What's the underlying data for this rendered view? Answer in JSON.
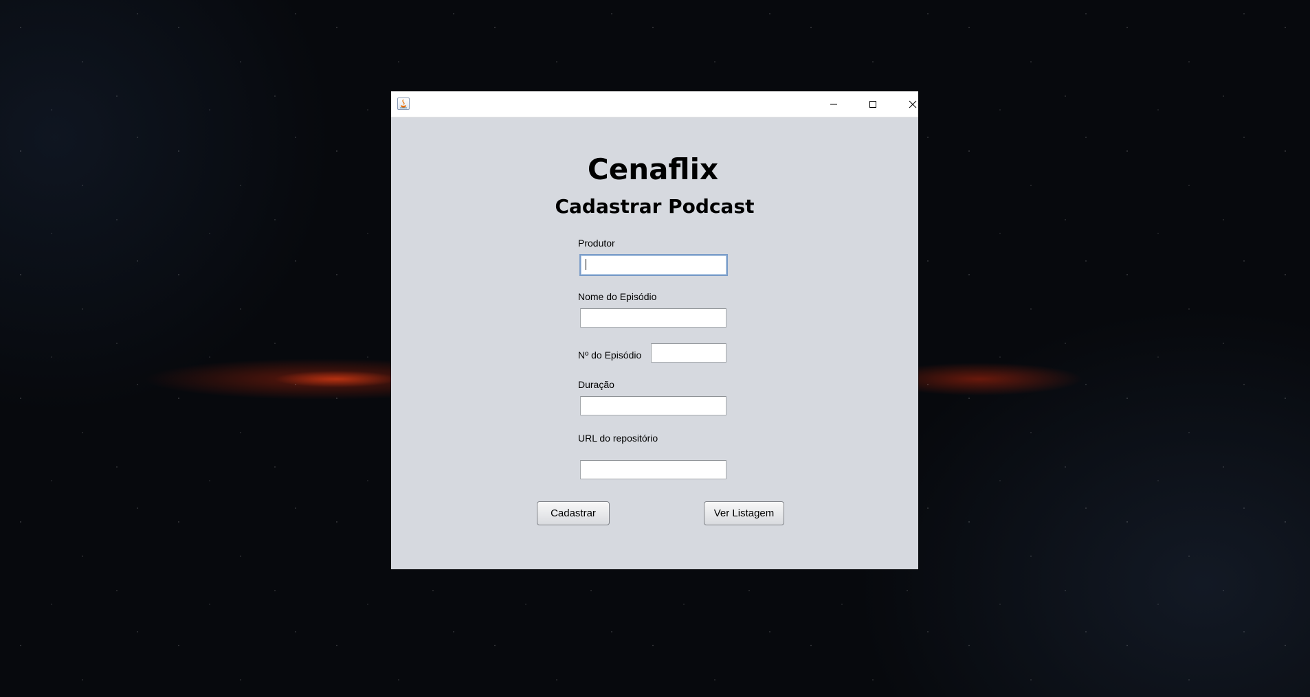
{
  "window": {
    "controls": {
      "minimize_icon": "minimize-icon",
      "maximize_icon": "maximize-icon",
      "close_icon": "close-icon"
    }
  },
  "header": {
    "title": "Cenaflix",
    "subtitle": "Cadastrar Podcast"
  },
  "form": {
    "produtor": {
      "label": "Produtor",
      "value": ""
    },
    "nome_episodio": {
      "label": "Nome do Episódio",
      "value": ""
    },
    "numero_episodio": {
      "label": "Nº do Episódio",
      "value": ""
    },
    "duracao": {
      "label": "Duração",
      "value": ""
    },
    "url_repositorio": {
      "label": "URL do repositório",
      "value": ""
    }
  },
  "actions": {
    "cadastrar_label": "Cadastrar",
    "ver_listagem_label": "Ver Listagem"
  },
  "colors": {
    "window_background": "#d6d9df",
    "titlebar": "#ffffff",
    "focus_border": "#7a9cc8"
  }
}
